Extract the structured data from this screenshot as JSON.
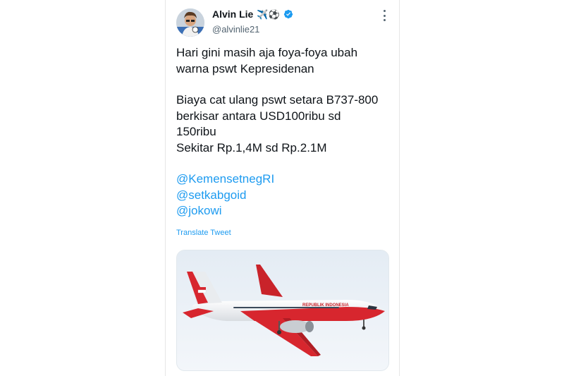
{
  "tweet": {
    "author_name": "Alvin Lie",
    "author_emoji": "✈️⚽",
    "handle": "@alvinlie21",
    "text_lines_1": [
      "Hari gini masih aja foya-foya ubah",
      "warna pswt Kepresidenan"
    ],
    "text_lines_2": [
      "Biaya cat ulang pswt setara B737-800",
      "berkisar antara USD100ribu sd",
      "150ribu",
      "Sekitar Rp.1,4M sd Rp.2.1M"
    ],
    "mentions": [
      "@KemensetnegRI",
      "@setkabgoid",
      "@jokowi"
    ],
    "translate_label": "Translate Tweet",
    "aircraft_livery_text": "REPUBLIK INDONESIA"
  },
  "icons": {
    "verified": "verified-badge-icon",
    "more": "more-options-icon"
  },
  "colors": {
    "accent": "#1d9bf0",
    "text": "#0f1419",
    "muted": "#536471",
    "livery_red": "#d7262e"
  }
}
